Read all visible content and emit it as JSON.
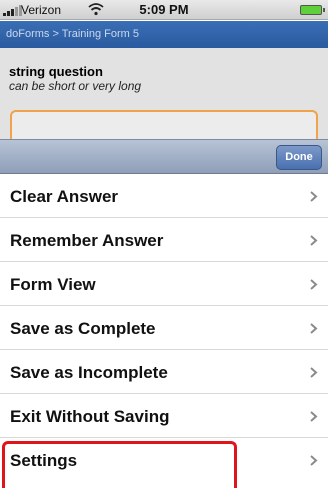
{
  "status_bar": {
    "carrier": "Verizon",
    "time": "5:09 PM",
    "signal_icon": "signal-bars-icon",
    "wifi_icon": "wifi-icon",
    "battery_icon": "battery-icon"
  },
  "breadcrumb": "doForms > Training Form 5",
  "question": {
    "title": "string question",
    "hint": "can be short or very long",
    "value": ""
  },
  "toolbar": {
    "done_label": "Done"
  },
  "menu": {
    "items": [
      {
        "label": "Clear Answer",
        "icon": "chevron-right-icon"
      },
      {
        "label": "Remember Answer",
        "icon": "chevron-right-icon"
      },
      {
        "label": "Form View",
        "icon": "chevron-right-icon"
      },
      {
        "label": "Save as Complete",
        "icon": "chevron-right-icon"
      },
      {
        "label": "Save as Incomplete",
        "icon": "chevron-right-icon"
      },
      {
        "label": "Exit Without Saving",
        "icon": "chevron-right-icon"
      },
      {
        "label": "Settings",
        "icon": "chevron-right-icon"
      }
    ]
  },
  "colors": {
    "nav_blue": "#2f63ab",
    "input_border": "#f1a24a",
    "highlight": "#e0141b"
  }
}
